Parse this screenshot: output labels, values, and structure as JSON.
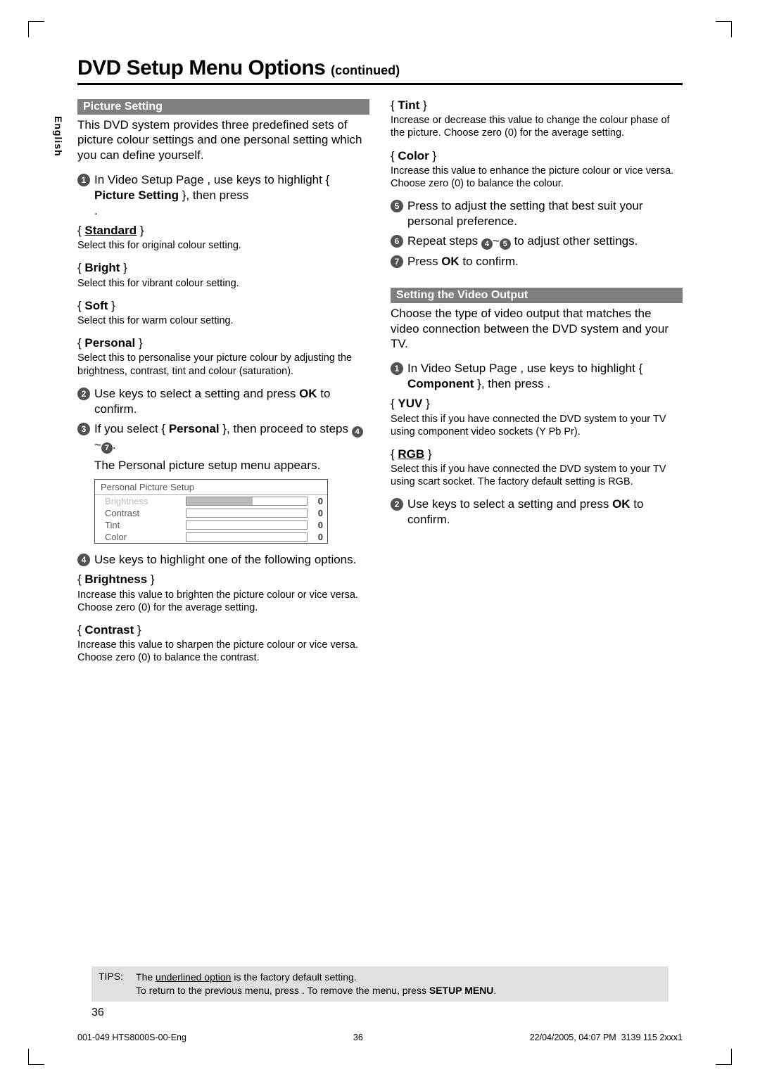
{
  "title": {
    "main": "DVD Setup Menu Options ",
    "sub": "(continued)"
  },
  "lang_tab": "English",
  "left": {
    "section_header": "Picture Setting",
    "intro": "This DVD system provides three predefined sets of picture colour settings and one personal setting which you can define yourself.",
    "step1_a": "In  Video Setup Page , use ",
    "step1_b": " keys to highlight { ",
    "step1_hl": "Picture Setting",
    "step1_c": " }, then press ",
    "step1_d": ".",
    "standard_label": "Standard",
    "standard_desc": "Select this for original colour setting.",
    "bright_label": "Bright",
    "bright_desc": "Select this for vibrant colour setting.",
    "soft_label": "Soft",
    "soft_desc": "Select this for warm colour setting.",
    "personal_label": "Personal",
    "personal_desc": "Select this to personalise your picture colour by adjusting the brightness, contrast, tint and colour (saturation).",
    "step2_a": "Use ",
    "step2_b": " keys to select a setting and press ",
    "step2_ok": "OK",
    "step2_c": " to confirm.",
    "step3_a": "If you select { ",
    "step3_hl": "Personal",
    "step3_b": " }, then proceed to steps ",
    "step3_c": ".",
    "step3_note": "The  Personal picture setup  menu appears.",
    "menu": {
      "title": "Personal Picture Setup",
      "rows": [
        {
          "label": "Brightness",
          "val": "0",
          "hl": true,
          "fill": true
        },
        {
          "label": "Contrast",
          "val": "0",
          "hl": false,
          "fill": false
        },
        {
          "label": "Tint",
          "val": "0",
          "hl": false,
          "fill": false
        },
        {
          "label": "Color",
          "val": "0",
          "hl": false,
          "fill": false
        }
      ]
    },
    "step4_a": "Use ",
    "step4_b": " keys to highlight one of the following options.",
    "brightness_label": "Brightness",
    "brightness_desc": "Increase this value to brighten the picture colour or vice versa. Choose zero (0) for the average setting.",
    "contrast_label": "Contrast",
    "contrast_desc": "Increase this value to sharpen the picture colour or vice versa.  Choose zero (0) to balance the contrast."
  },
  "right": {
    "tint_label": "Tint",
    "tint_desc": "Increase or decrease this value to change the colour phase of the picture.  Choose zero (0) for the average setting.",
    "color_label": "Color",
    "color_desc": "Increase this value to enhance the picture colour or vice versa. Choose zero (0) to balance the colour.",
    "step5_a": "Press ",
    "step5_b": " to adjust the setting that best suit your personal preference.",
    "step6_a": "Repeat steps ",
    "step6_b": " to adjust other settings.",
    "step7_a": "Press ",
    "step7_ok": "OK",
    "step7_b": " to confirm.",
    "section_header2": "Setting the Video Output",
    "vo_intro": "Choose the type of video output that matches the video connection between the DVD system and your TV.",
    "vo_step1_a": "In  Video Setup Page , use ",
    "vo_step1_b": " keys to highlight { ",
    "vo_step1_hl": "Component",
    "vo_step1_c": " }, then press ",
    "vo_step1_d": ".",
    "yuv_label": "YUV",
    "yuv_desc": "Select this if you have connected the DVD system to your TV using component video sockets (Y Pb Pr).",
    "rgb_label": "RGB",
    "rgb_desc": "Select this if you have connected the DVD system to your TV using scart socket. The factory default setting is RGB.",
    "vo_step2_a": "Use ",
    "vo_step2_b": " keys to select a setting and press ",
    "vo_step2_ok": "OK",
    "vo_step2_c": " to confirm."
  },
  "tips": {
    "label": "TIPS:",
    "line1_a": "The ",
    "line1_u": "underlined option",
    "line1_b": " is the factory default setting.",
    "line2_a": "To return to the previous menu, press ",
    "line2_b": ".  To remove the menu, press ",
    "line2_hl": "SETUP MENU",
    "line2_c": "."
  },
  "pagenum": "36",
  "footer": {
    "left": "001-049 HTS8000S-00-Eng",
    "center": "36",
    "right_a": "22/04/2005, 04:07 PM",
    "right_b": "3139 115 2xxx1"
  }
}
